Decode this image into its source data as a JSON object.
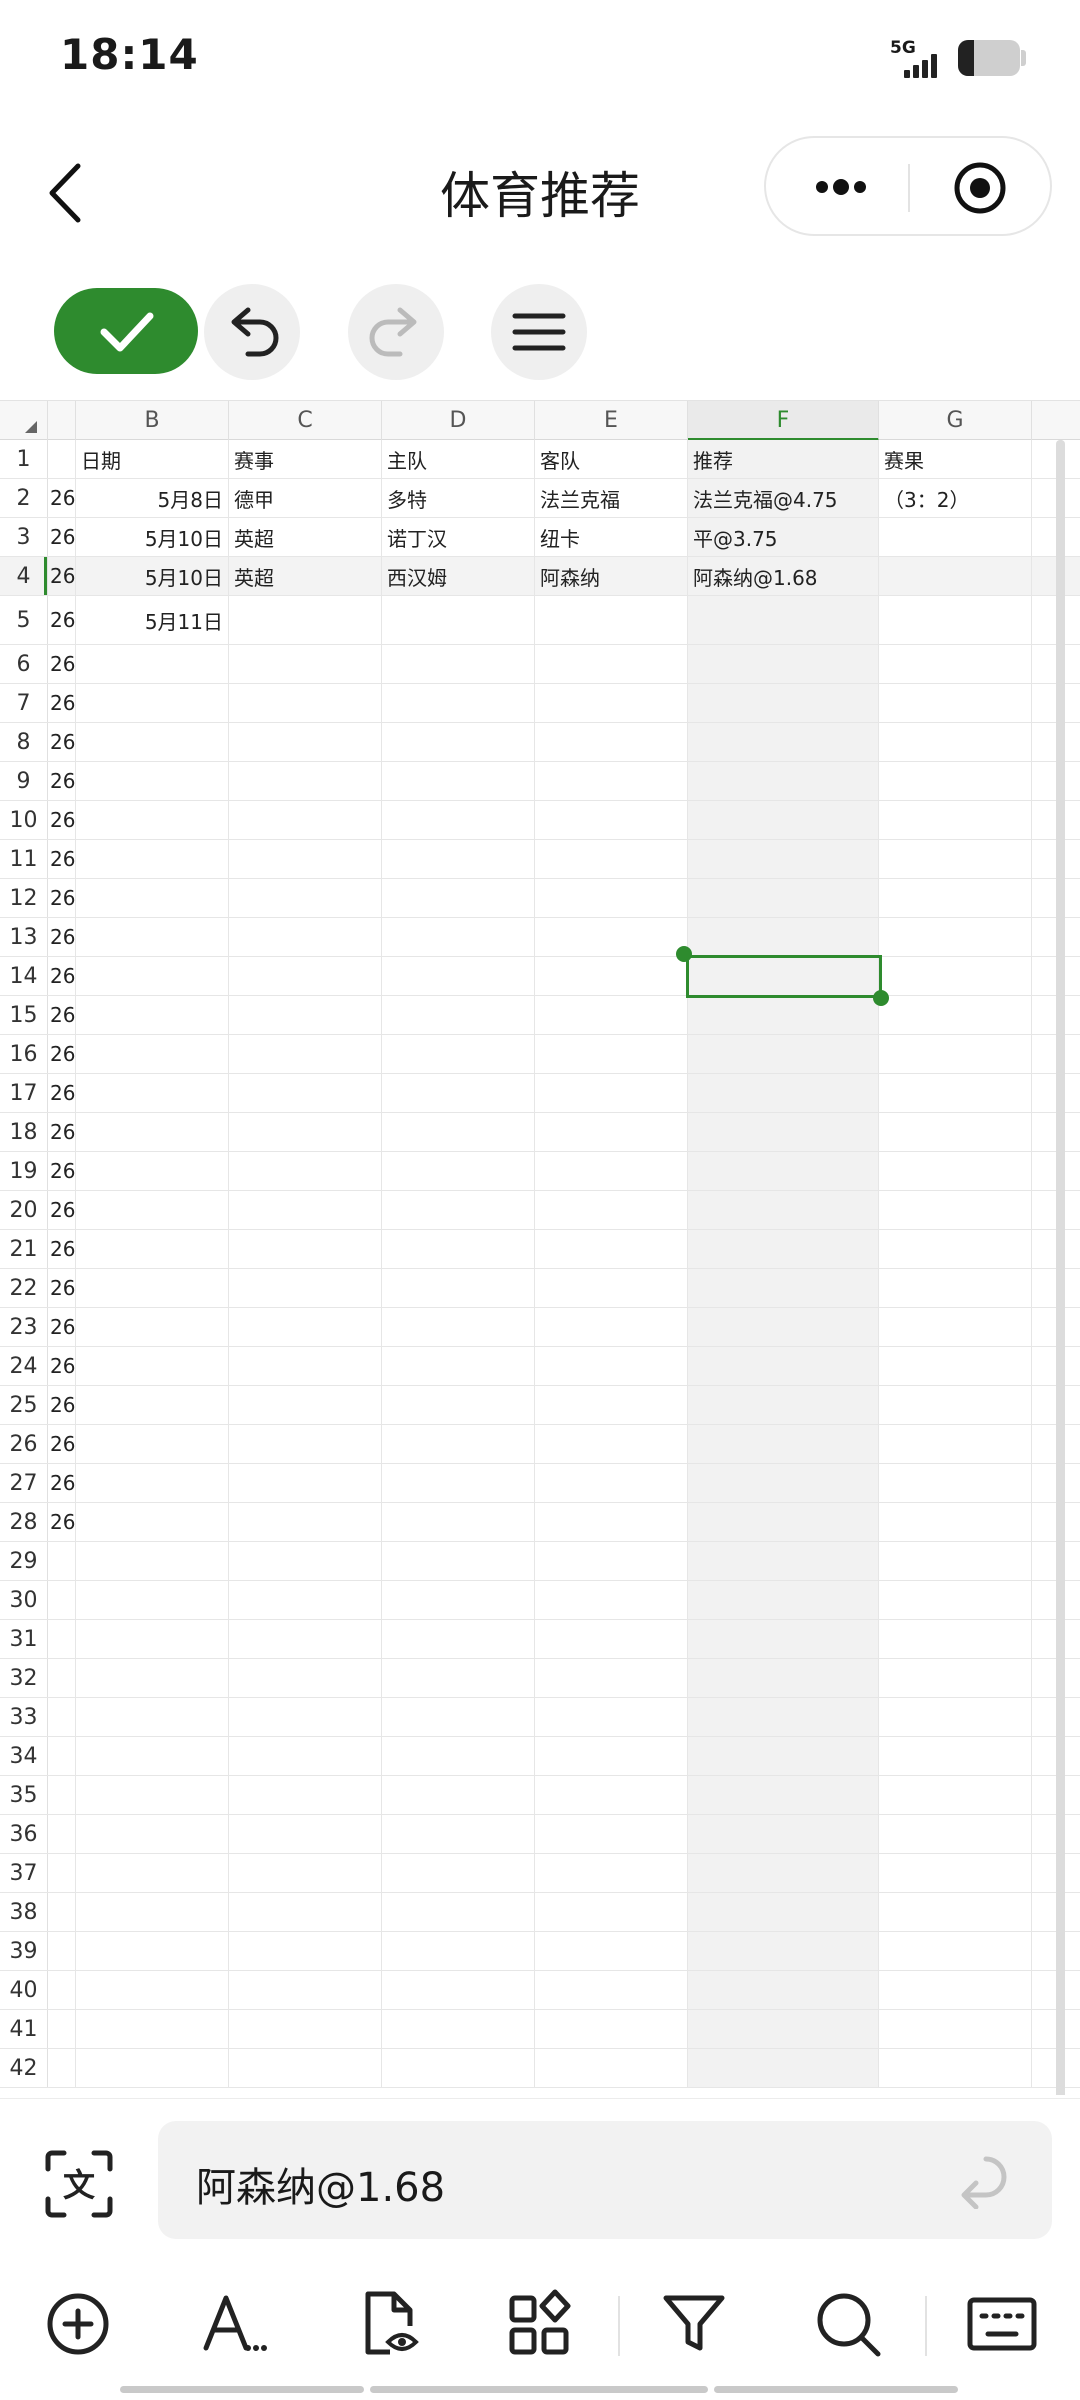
{
  "status": {
    "time": "18:14",
    "network": "5G"
  },
  "nav": {
    "title": "体育推荐"
  },
  "columns": [
    "B",
    "C",
    "D",
    "E",
    "F",
    "G"
  ],
  "selected_column": "F",
  "selected_row": 4,
  "row_numbers": [
    "1",
    "2",
    "3",
    "4",
    "5",
    "6",
    "7",
    "8",
    "9",
    "10",
    "11",
    "12",
    "13",
    "14",
    "15",
    "16",
    "17",
    "18",
    "19",
    "20",
    "21",
    "22",
    "23",
    "24",
    "25",
    "26",
    "27",
    "28",
    "29",
    "30",
    "31",
    "32",
    "33",
    "34",
    "35",
    "36",
    "37",
    "38",
    "39",
    "40",
    "41",
    "42"
  ],
  "col_a_values": [
    "",
    "26",
    "26",
    "26",
    "26",
    "26",
    "26",
    "26",
    "26",
    "26",
    "26",
    "26",
    "26",
    "26",
    "26",
    "26",
    "26",
    "26",
    "26",
    "26",
    "26",
    "26",
    "26",
    "26",
    "26",
    "26",
    "26",
    "26"
  ],
  "rows": [
    {
      "B": "日期",
      "C": "赛事",
      "D": "主队",
      "E": "客队",
      "F": "推荐",
      "G": "赛果"
    },
    {
      "B": "5月8日",
      "C": "德甲",
      "D": "多特",
      "E": "法兰克福",
      "F": "法兰克福@4.75",
      "G": "（3：2）"
    },
    {
      "B": "5月10日",
      "C": "英超",
      "D": "诺丁汉",
      "E": "纽卡",
      "F": "平@3.75",
      "G": ""
    },
    {
      "B": "5月10日",
      "C": "英超",
      "D": "西汉姆",
      "E": "阿森纳",
      "F": "阿森纳@1.68",
      "G": ""
    },
    {
      "B": "5月11日",
      "C": "",
      "D": "",
      "E": "",
      "F": "",
      "G": ""
    }
  ],
  "formula": {
    "value": "阿森纳@1.68"
  },
  "colors": {
    "accent": "#2e8b2e",
    "selected_bg": "#f2f2f2"
  },
  "icons": {
    "toolbar": [
      "check-icon",
      "undo-icon",
      "redo-icon",
      "menu-icon"
    ],
    "bottom": [
      "add-circle-icon",
      "text-format-icon",
      "file-preview-icon",
      "apps-icon",
      "filter-icon",
      "search-icon",
      "keyboard-icon"
    ]
  }
}
